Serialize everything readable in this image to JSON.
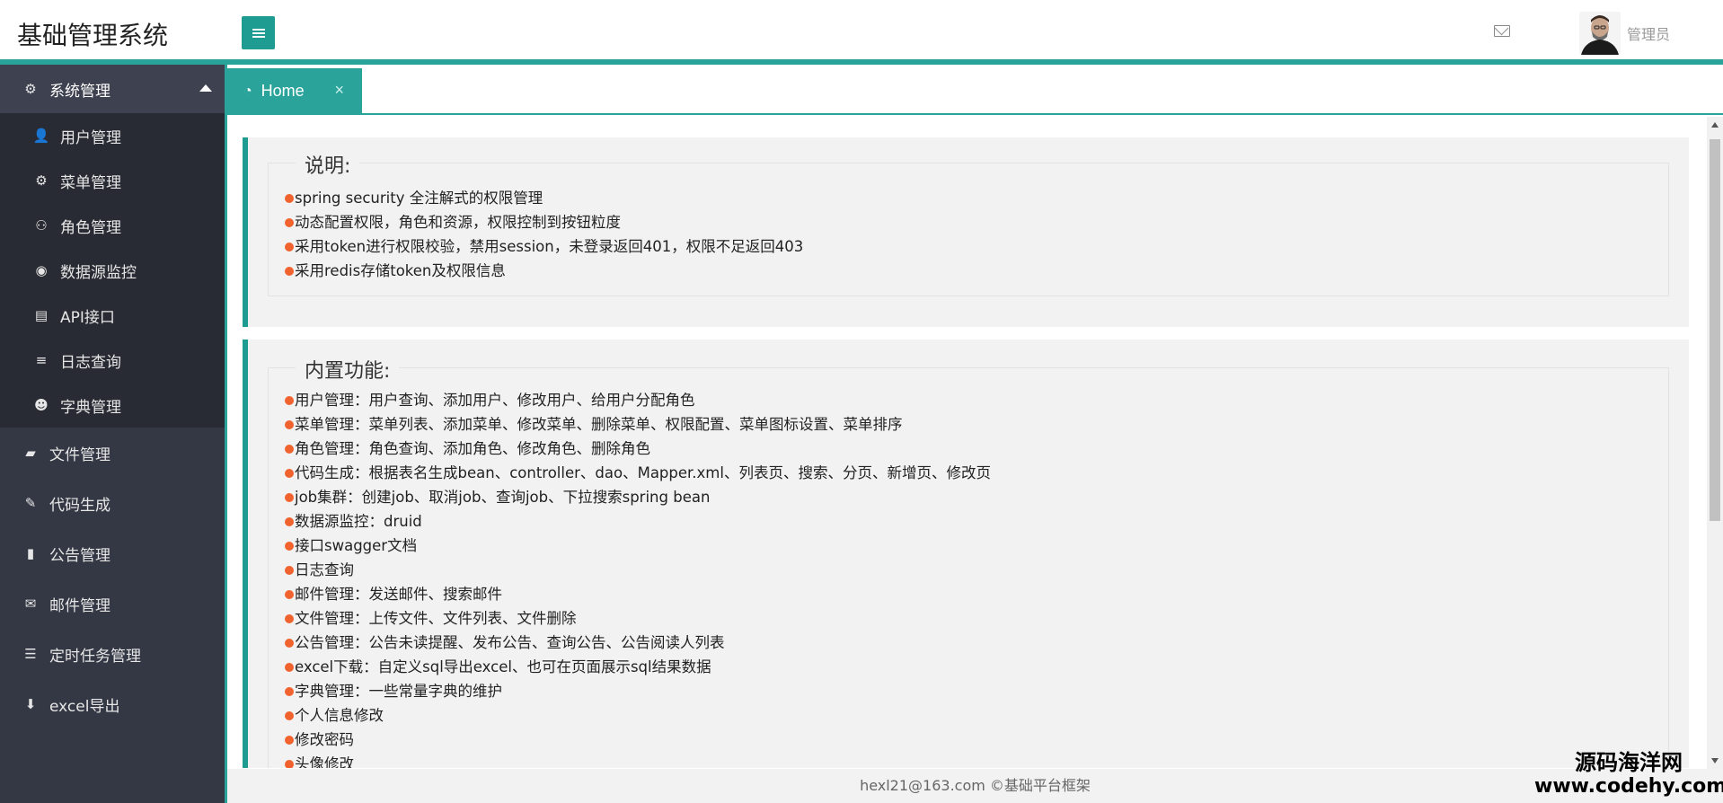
{
  "header": {
    "logo": "基础管理系统",
    "user_name": "管理员",
    "icons": {
      "menu_toggle": "bars-icon",
      "mail": "envelope-icon"
    }
  },
  "sidebar": {
    "group": {
      "label": "系统管理",
      "icon": "cogs-icon",
      "expanded": true
    },
    "sub_items": [
      {
        "label": "用户管理",
        "icon": "user-icon"
      },
      {
        "label": "菜单管理",
        "icon": "gear-icon"
      },
      {
        "label": "角色管理",
        "icon": "users-icon"
      },
      {
        "label": "数据源监控",
        "icon": "eye-icon"
      },
      {
        "label": "API接口",
        "icon": "file-pdf-icon"
      },
      {
        "label": "日志查询",
        "icon": "list-icon"
      },
      {
        "label": "字典管理",
        "icon": "reddit-icon"
      }
    ],
    "items": [
      {
        "label": "文件管理",
        "icon": "folder-open-icon"
      },
      {
        "label": "代码生成",
        "icon": "wrench-icon"
      },
      {
        "label": "公告管理",
        "icon": "book-icon"
      },
      {
        "label": "邮件管理",
        "icon": "envelope-icon"
      },
      {
        "label": "定时任务管理",
        "icon": "tasks-icon"
      },
      {
        "label": "excel导出",
        "icon": "download-icon"
      }
    ]
  },
  "tabs": [
    {
      "label": "Home",
      "icon": "dashboard-icon",
      "active": true
    }
  ],
  "panels": {
    "description": {
      "title": "说明:",
      "items": [
        "spring security 全注解式的权限管理",
        "动态配置权限，角色和资源，权限控制到按钮粒度",
        "采用token进行权限校验，禁用session，未登录返回401，权限不足返回403",
        "采用redis存储token及权限信息"
      ]
    },
    "features": {
      "title": "内置功能:",
      "items": [
        "用户管理：用户查询、添加用户、修改用户、给用户分配角色",
        "菜单管理：菜单列表、添加菜单、修改菜单、删除菜单、权限配置、菜单图标设置、菜单排序",
        "角色管理：角色查询、添加角色、修改角色、删除角色",
        "代码生成：根据表名生成bean、controller、dao、Mapper.xml、列表页、搜索、分页、新增页、修改页",
        "job集群：创建job、取消job、查询job、下拉搜索spring bean",
        "数据源监控：druid",
        "接口swagger文档",
        "日志查询",
        "邮件管理：发送邮件、搜索邮件",
        "文件管理：上传文件、文件列表、文件删除",
        "公告管理：公告未读提醒、发布公告、查询公告、公告阅读人列表",
        "excel下载：自定义sql导出excel、也可在页面展示sql结果数据",
        "字典管理：一些常量字典的维护",
        "个人信息修改",
        "修改密码",
        "头像修改"
      ]
    }
  },
  "footer": {
    "text": "hexl21@163.com ©基础平台框架"
  },
  "watermark": {
    "line1": "源码海洋网",
    "line2": "www.codehy.com"
  },
  "colors": {
    "accent": "#2aa39a",
    "sidebar_bg": "#343845",
    "submenu_bg": "#282b33",
    "bullet": "#f0622e"
  }
}
